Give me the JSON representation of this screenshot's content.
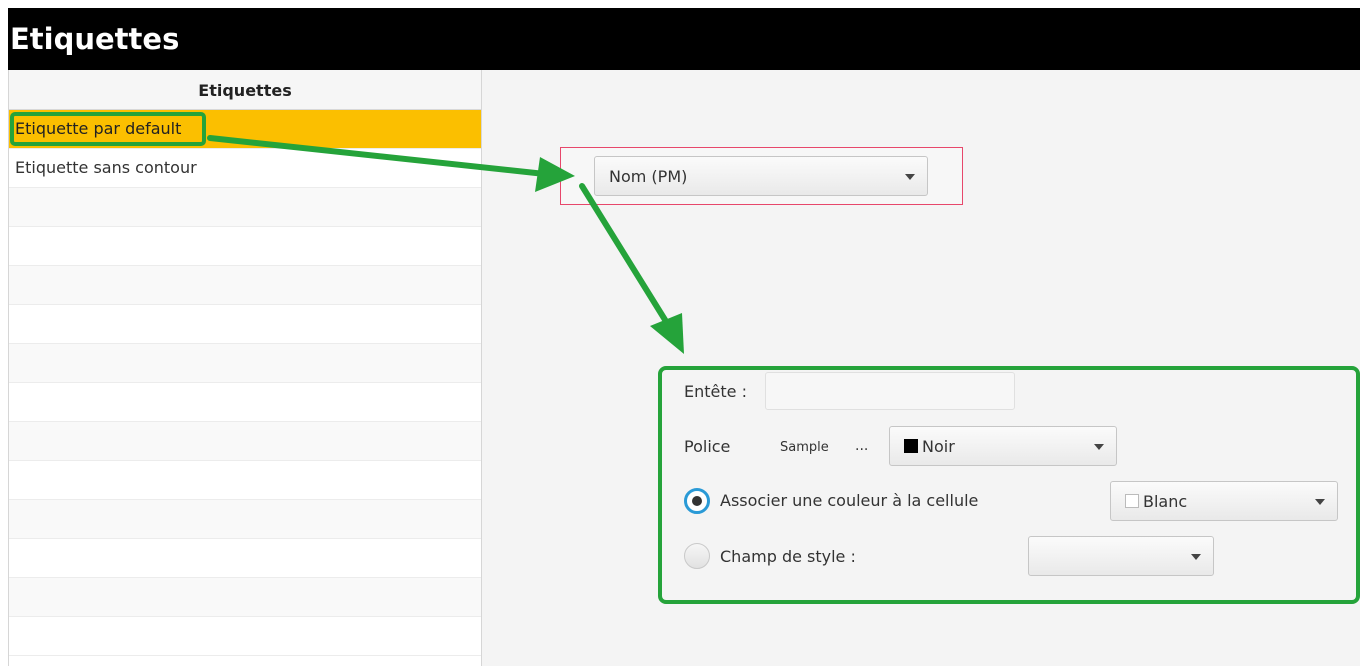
{
  "window": {
    "title": "Etiquettes"
  },
  "list": {
    "header": "Etiquettes",
    "items": [
      {
        "label": "Etiquette par default",
        "selected": true
      },
      {
        "label": "Etiquette sans contour",
        "selected": false
      }
    ]
  },
  "selector": {
    "value": "Nom (PM)"
  },
  "form": {
    "header_label": "Entête :",
    "header_value": "",
    "police_label": "Police",
    "police_sample": "Sample",
    "police_more": "...",
    "police_color": "Noir",
    "associate_label": "Associer une couleur à la cellule",
    "associate_color": "Blanc",
    "associate_selected": true,
    "style_field_label": "Champ de style :",
    "style_field_value": "",
    "style_field_selected": false
  },
  "colors": {
    "selection": "#fbbf00",
    "annotation_green": "#25a33a",
    "annotation_pink": "#e7476b",
    "black_swatch": "#000000",
    "white_swatch": "#ffffff"
  }
}
